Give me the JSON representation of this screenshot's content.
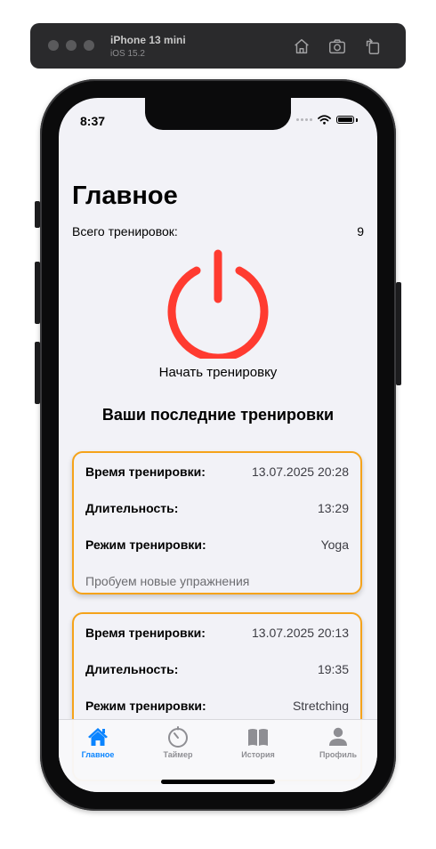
{
  "simulator": {
    "device": "iPhone 13 mini",
    "os": "iOS 15.2",
    "icons": [
      "home-icon",
      "screenshot-icon",
      "rotate-icon"
    ]
  },
  "status_bar": {
    "time": "8:37"
  },
  "header": {
    "title": "Главное",
    "total_label": "Всего тренировок:",
    "total_value": "9"
  },
  "start": {
    "label": "Начать тренировку",
    "icon": "power-icon",
    "color": "#ff3b30"
  },
  "recent": {
    "title": "Ваши последние тренировки",
    "accent_color": "#f5a31a",
    "cards": [
      {
        "time_label": "Время тренировки:",
        "time": "13.07.2025 20:28",
        "duration_label": "Длительность:",
        "duration": "13:29",
        "mode_label": "Режим тренировки:",
        "mode": "Yoga",
        "note": "Пробуем новые упражнения"
      },
      {
        "time_label": "Время тренировки:",
        "time": "13.07.2025 20:13",
        "duration_label": "Длительность:",
        "duration": "19:35",
        "mode_label": "Режим тренировки:",
        "mode": "Stretching"
      }
    ]
  },
  "tabbar": {
    "active_color": "#0a84ff",
    "tabs": [
      {
        "label": "Главное",
        "icon": "house-icon",
        "active": true
      },
      {
        "label": "Таймер",
        "icon": "timer-icon",
        "active": false
      },
      {
        "label": "История",
        "icon": "book-icon",
        "active": false
      },
      {
        "label": "Профиль",
        "icon": "person-icon",
        "active": false
      }
    ]
  }
}
